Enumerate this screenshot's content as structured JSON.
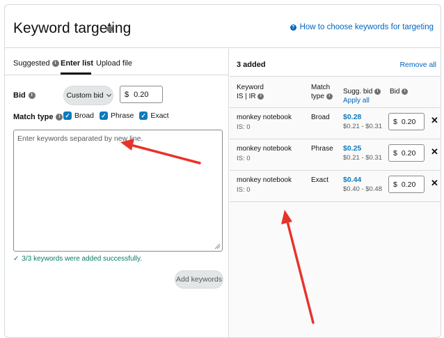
{
  "header": {
    "title": "Keyword targeting",
    "help_link": "How to choose keywords for targeting"
  },
  "tabs": [
    {
      "label": "Suggested",
      "active": false
    },
    {
      "label": "Enter list",
      "active": true
    },
    {
      "label": "Upload file",
      "active": false
    }
  ],
  "form": {
    "bid_label": "Bid",
    "bid_select": "Custom bid",
    "currency": "$",
    "bid_value": "0.20",
    "match_type_label": "Match type",
    "match_types": [
      {
        "label": "Broad",
        "checked": true
      },
      {
        "label": "Phrase",
        "checked": true
      },
      {
        "label": "Exact",
        "checked": true
      }
    ],
    "textarea_placeholder": "Enter keywords separated by new line.",
    "success_message": "3/3 keywords were added successfully.",
    "add_button": "Add keywords"
  },
  "added_panel": {
    "count_label": "3 added",
    "remove_all": "Remove all",
    "columns": {
      "keyword": "Keyword",
      "keyword_sub": "IS | IR",
      "match_type_1": "Match",
      "match_type_2": "type",
      "sugg_bid": "Sugg. bid",
      "apply_all": "Apply all",
      "bid": "Bid"
    },
    "rows": [
      {
        "keyword": "monkey notebook",
        "is": "IS: 0",
        "match": "Broad",
        "sugg": "$0.28",
        "range": "$0.21 - $0.31",
        "currency": "$",
        "bid": "0.20"
      },
      {
        "keyword": "monkey notebook",
        "is": "IS: 0",
        "match": "Phrase",
        "sugg": "$0.25",
        "range": "$0.21 - $0.31",
        "currency": "$",
        "bid": "0.20"
      },
      {
        "keyword": "monkey notebook",
        "is": "IS: 0",
        "match": "Exact",
        "sugg": "$0.44",
        "range": "$0.40 - $0.48",
        "currency": "$",
        "bid": "0.20"
      }
    ]
  },
  "colors": {
    "link": "#0066c0",
    "checkbox": "#0a7bbd",
    "success": "#067d62",
    "annotation_arrow": "#e8332a"
  }
}
